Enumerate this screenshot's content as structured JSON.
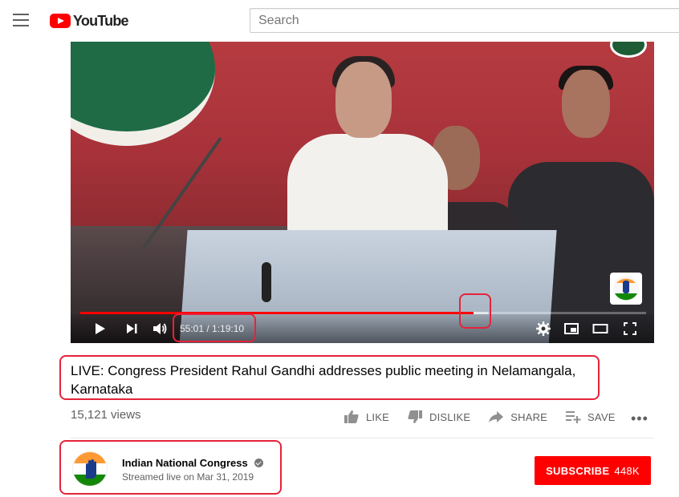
{
  "header": {
    "logo_text": "YouTube",
    "search_placeholder": "Search"
  },
  "player": {
    "current_time": "55:01",
    "duration": "1:19:10",
    "progress_fraction": 0.695,
    "buffered_fraction": 0.72
  },
  "video": {
    "title": "LIVE: Congress President Rahul Gandhi addresses public meeting in Nelamangala, Karnataka",
    "views": "15,121 views",
    "actions": {
      "like": "LIKE",
      "dislike": "DISLIKE",
      "share": "SHARE",
      "save": "SAVE"
    },
    "more": "•••"
  },
  "channel": {
    "name": "Indian National Congress",
    "streamed": "Streamed live on Mar 31, 2019",
    "subscribe_label": "SUBSCRIBE",
    "subscriber_count": "448K"
  },
  "colors": {
    "accent": "#ff0000",
    "highlight": "#e5233b"
  }
}
